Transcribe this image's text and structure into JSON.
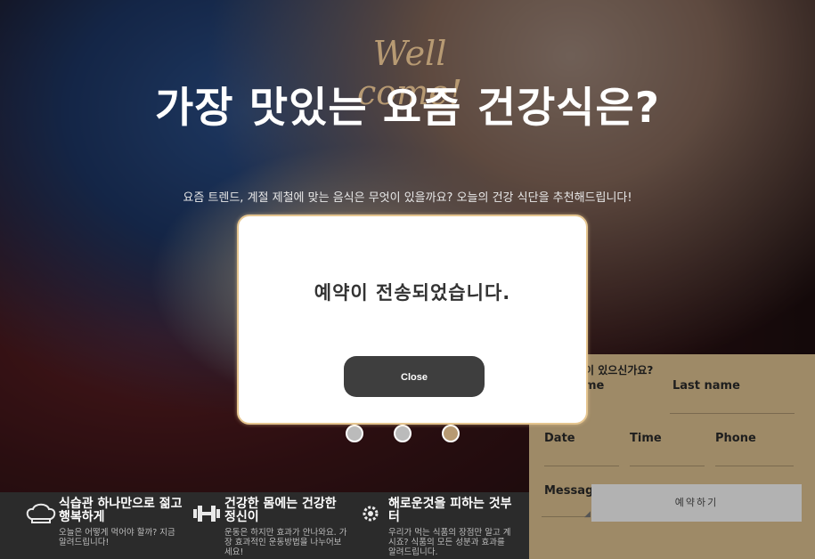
{
  "hero": {
    "welcome": "Well come!",
    "headline": "가장 맛있는 요즘 건강식은?",
    "subline": "요즘 트렌드, 계절 제철에 맞는 음식은 무엇이 있을까요? 오늘의 건강 식단을 추천해드립니다!",
    "slider": {
      "count": 3,
      "active_index": 2
    }
  },
  "features": [
    {
      "icon": "chef-hat-icon",
      "title": "식습관 하나만으로 젊고 행복하게",
      "desc": "오늘은 어떻게 먹어야 할까? 지금 알려드립니다!"
    },
    {
      "icon": "dumbbell-icon",
      "title": "건강한 몸에는 건강한 정신이",
      "desc": "운동은 하지만 효과가 안나와요. 가장 효과적인 운동방법을 나누어보세요!"
    },
    {
      "icon": "gear-icon",
      "title": "해로운것을 피하는 것부터",
      "desc": "우리가 먹는 식품의 장점만 알고 계시죠? 식품의 모든 성분과 효과를 알려드립니다."
    }
  ],
  "form": {
    "question": "이 있으신가요?",
    "first_name_label": "me",
    "last_name_label": "Last name",
    "date_label": "Date",
    "time_label": "Time",
    "phone_label": "Phone",
    "message_label": "Message",
    "submit_label": "예약하기"
  },
  "modal": {
    "message": "예약이 전송되었습니다.",
    "close_label": "Close"
  }
}
